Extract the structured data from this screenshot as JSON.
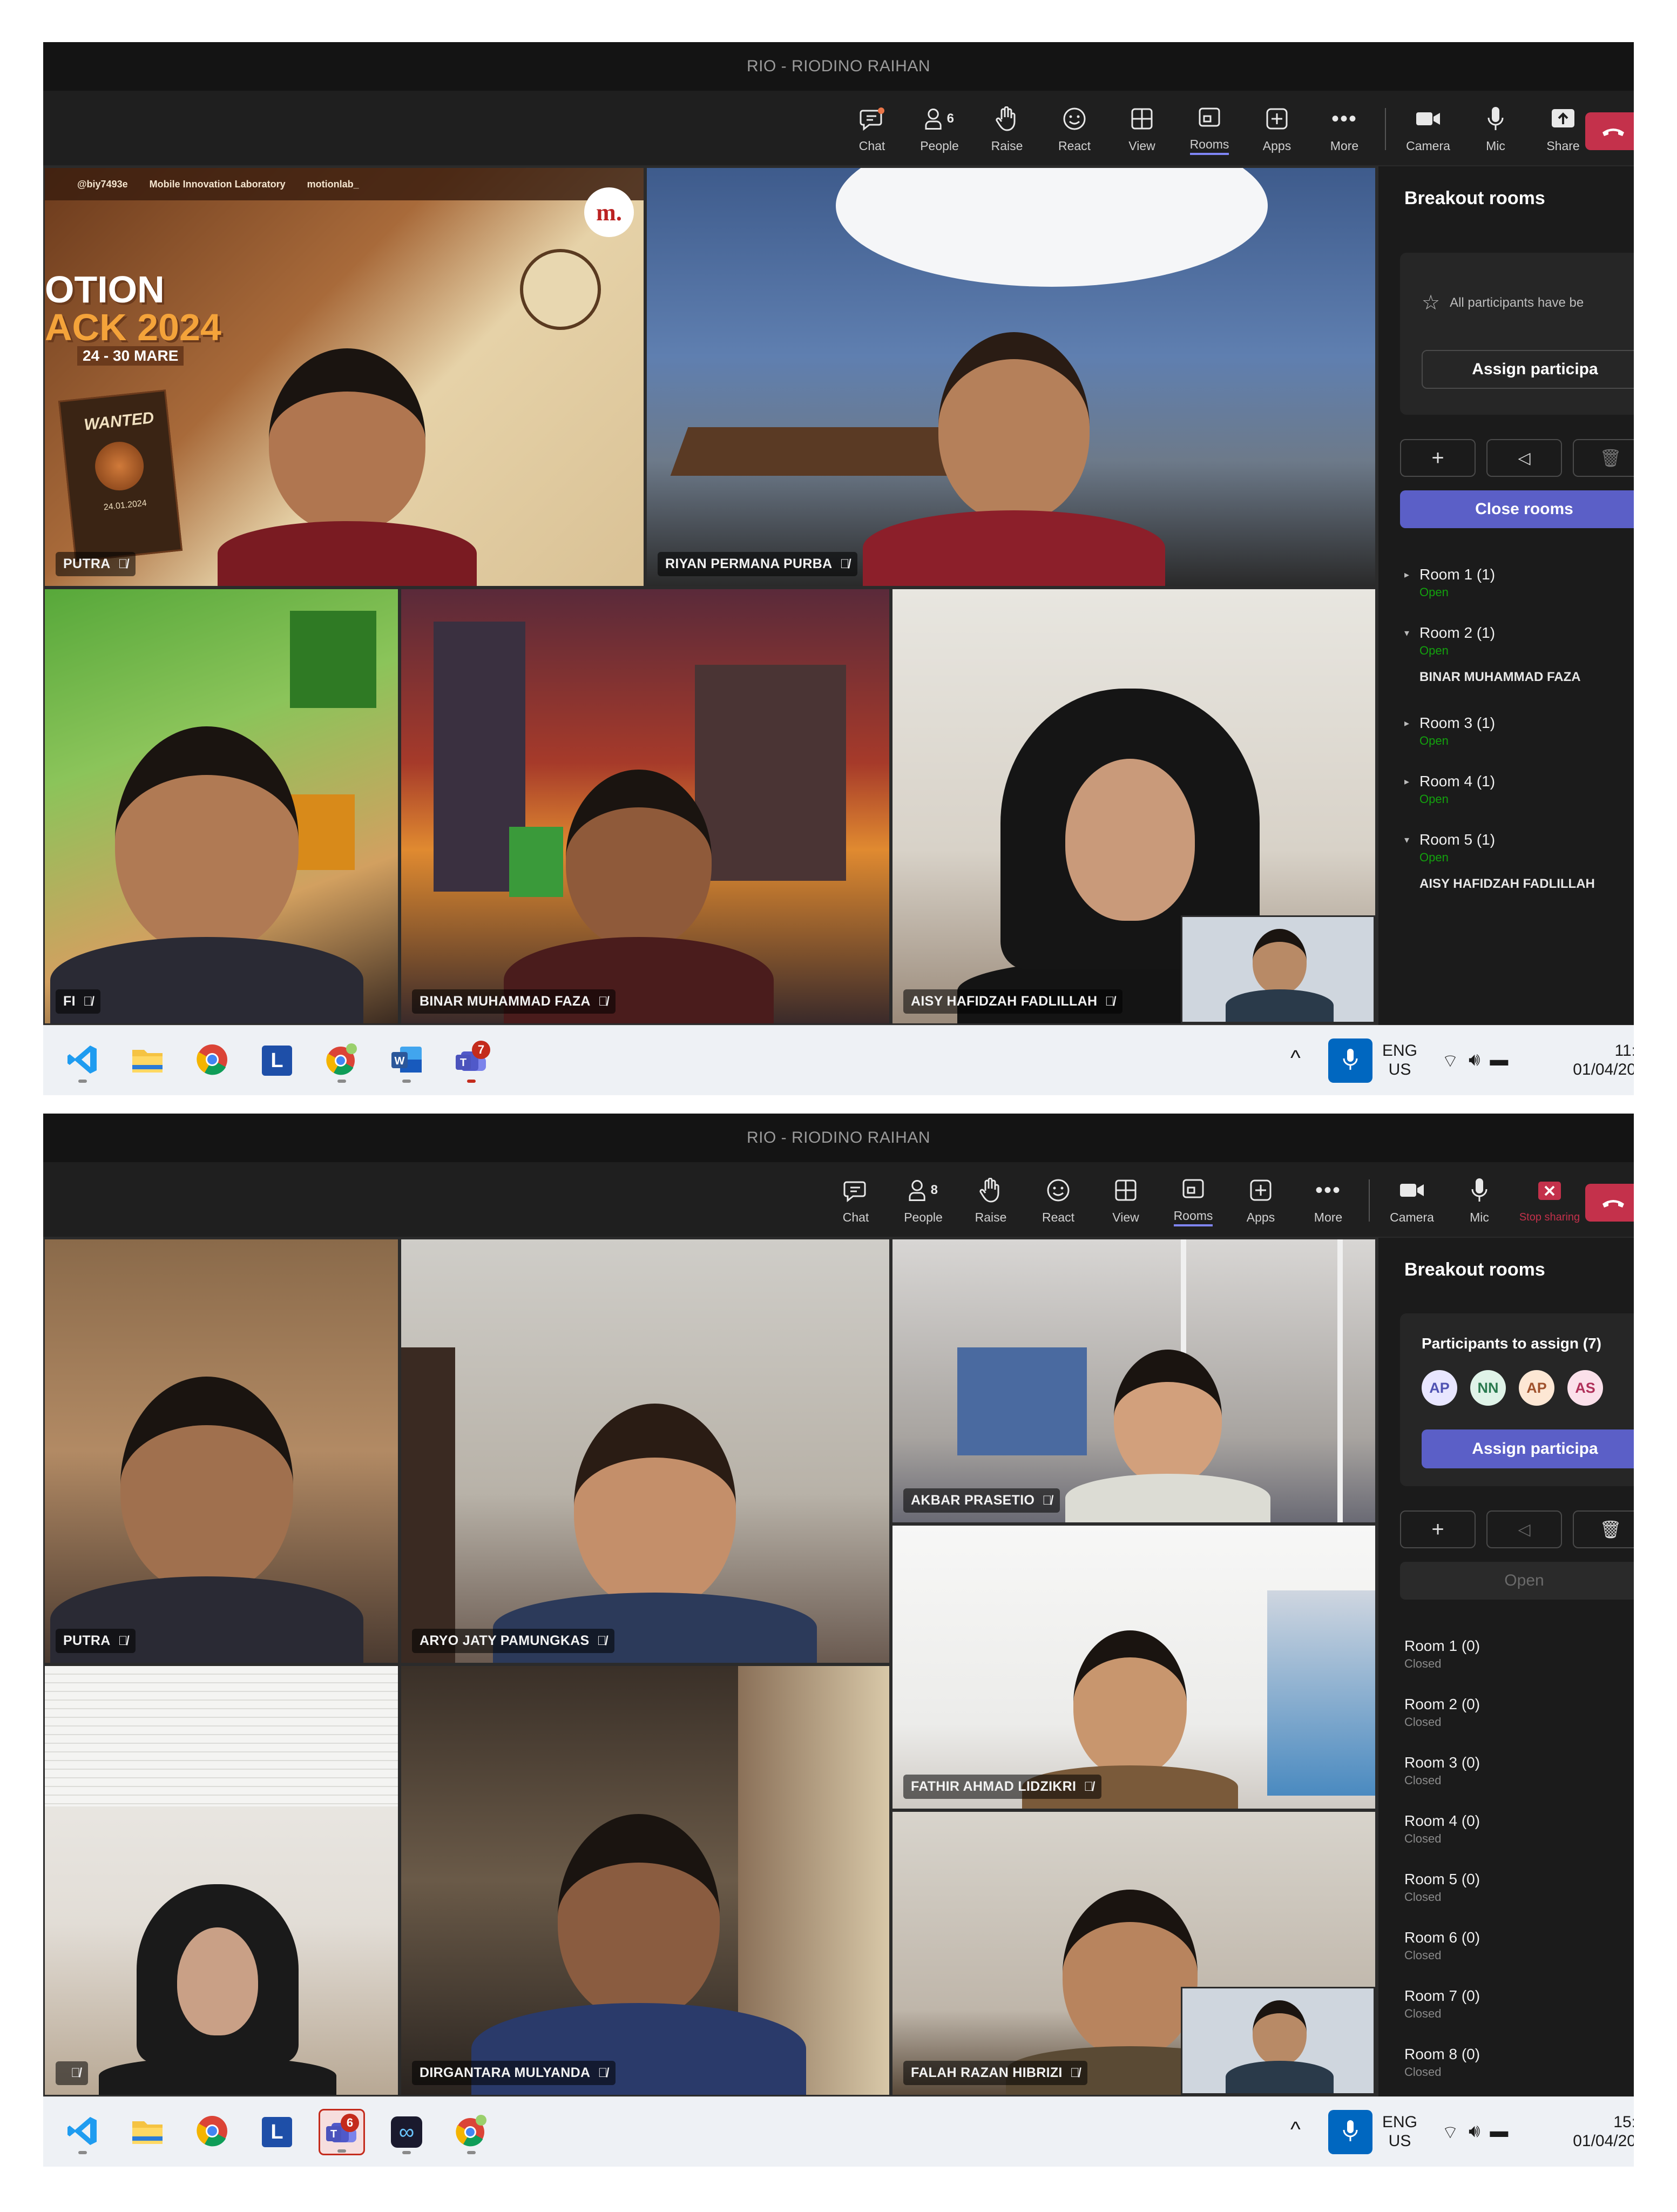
{
  "window_title": "RIO - RIODINO RAIHAN",
  "toolbar": {
    "chat": "Chat",
    "people": "People",
    "raise": "Raise",
    "react": "React",
    "view": "View",
    "rooms": "Rooms",
    "apps": "Apps",
    "more": "More",
    "camera": "Camera",
    "mic": "Mic",
    "share": "Share",
    "stop_sharing": "Stop sharing"
  },
  "screen1": {
    "people_count": "6",
    "tiles": [
      {
        "name": "PUTRA",
        "poster_handle": "@biy7493e",
        "poster_lab": "Mobile Innovation Laboratory",
        "poster_ig": "motionlab_",
        "poster_title_1": "OTION",
        "poster_title_2": "ACK 2024",
        "poster_dates": "24 - 30 MARE",
        "poster_wanted": "WANTED",
        "poster_date_small": "24.01.2024"
      },
      {
        "name": "RIYAN PERMANA PURBA"
      },
      {
        "name": "FI"
      },
      {
        "name": "BINAR MUHAMMAD FAZA"
      },
      {
        "name": "AISY HAFIDZAH FADLILLAH"
      }
    ],
    "panel": {
      "title": "Breakout rooms",
      "notice": "All participants have be",
      "assign_label": "Assign participa",
      "close_rooms": "Close rooms",
      "rooms": [
        {
          "name": "Room 1 (1)",
          "status": "Open",
          "participant": ""
        },
        {
          "name": "Room 2 (1)",
          "status": "Open",
          "participant": "BINAR MUHAMMAD FAZA"
        },
        {
          "name": "Room 3 (1)",
          "status": "Open",
          "participant": ""
        },
        {
          "name": "Room 4 (1)",
          "status": "Open",
          "participant": ""
        },
        {
          "name": "Room 5 (1)",
          "status": "Open",
          "participant": "AISY HAFIDZAH FADLILLAH"
        }
      ]
    },
    "taskbar": {
      "teams_badge": "7",
      "lang": "ENG",
      "region": "US",
      "time": "11:",
      "date": "01/04/20"
    }
  },
  "screen2": {
    "people_count": "8",
    "tiles": [
      {
        "name": "PUTRA"
      },
      {
        "name": "ARYO JATY PAMUNGKAS"
      },
      {
        "name": "AKBAR PRASETIO"
      },
      {
        "name": "FATHIR AHMAD LIDZIKRI"
      },
      {
        "name": ""
      },
      {
        "name": "DIRGANTARA MULYANDA"
      },
      {
        "name": "FALAH RAZAN HIBRIZI"
      }
    ],
    "panel": {
      "title": "Breakout rooms",
      "participants_to_assign": "Participants to assign (7)",
      "avatars": [
        {
          "initials": "AP",
          "bg": "#e8e6ff",
          "fg": "#4f52b2"
        },
        {
          "initials": "NN",
          "bg": "#dff3e8",
          "fg": "#2a7a4f"
        },
        {
          "initials": "AP",
          "bg": "#fde7d4",
          "fg": "#a0522d"
        },
        {
          "initials": "AS",
          "bg": "#fbe0ea",
          "fg": "#b0305a"
        }
      ],
      "assign_label": "Assign participa",
      "open_label": "Open",
      "rooms": [
        {
          "name": "Room 1 (0)",
          "status": "Closed"
        },
        {
          "name": "Room 2 (0)",
          "status": "Closed"
        },
        {
          "name": "Room 3 (0)",
          "status": "Closed"
        },
        {
          "name": "Room 4 (0)",
          "status": "Closed"
        },
        {
          "name": "Room 5 (0)",
          "status": "Closed"
        },
        {
          "name": "Room 6 (0)",
          "status": "Closed"
        },
        {
          "name": "Room 7 (0)",
          "status": "Closed"
        },
        {
          "name": "Room 8 (0)",
          "status": "Closed"
        }
      ]
    },
    "taskbar": {
      "teams_badge": "6",
      "lang": "ENG",
      "region": "US",
      "time": "15:",
      "date": "01/04/20"
    }
  },
  "colors": {
    "accent": "#5b5fc7",
    "leave": "#c4314b",
    "open_status": "#13a10e"
  }
}
